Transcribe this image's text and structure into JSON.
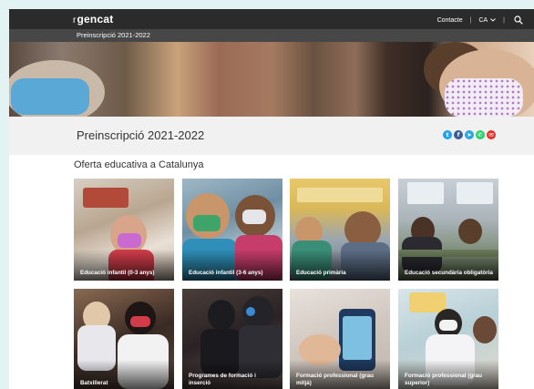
{
  "header": {
    "logo": "gencat",
    "logo_mark": "r",
    "contact_label": "Contacte",
    "language_label": "CA",
    "subtitle": "Preinscripció 2021-2022"
  },
  "title": "Preinscripció 2021-2022",
  "share_icons": [
    {
      "name": "twitter",
      "glyph": "t",
      "color": "#1da1f2"
    },
    {
      "name": "facebook",
      "glyph": "f",
      "color": "#3b5998"
    },
    {
      "name": "telegram",
      "glyph": "➤",
      "color": "#2ca5e0"
    },
    {
      "name": "whatsapp",
      "glyph": "✆",
      "color": "#25d366"
    },
    {
      "name": "email",
      "glyph": "✉",
      "color": "#e4322b"
    }
  ],
  "section_title": "Oferta educativa a Catalunya",
  "cards": [
    {
      "label": "Educació infantil (0-3 anys)"
    },
    {
      "label": "Educació infantil (3-6 anys)"
    },
    {
      "label": "Educació primària"
    },
    {
      "label": "Educació secundària obligatòria"
    },
    {
      "label": "Batxillerat"
    },
    {
      "label": "Programes de formació i inserció"
    },
    {
      "label": "Formació professional (grau mitjà)"
    },
    {
      "label": "Formació professional (grau superior)"
    }
  ]
}
